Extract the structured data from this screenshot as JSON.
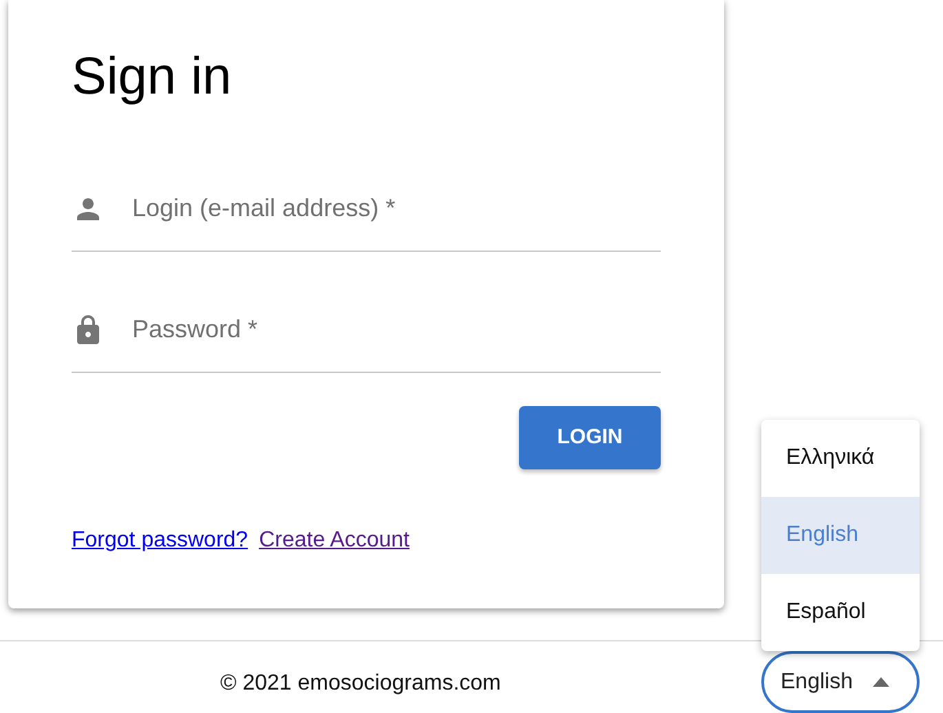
{
  "sign_in": {
    "title": "Sign in",
    "fields": [
      {
        "kind": "user",
        "placeholder": "Login (e-mail address) *"
      },
      {
        "kind": "password",
        "placeholder": "Password *"
      }
    ],
    "login_button": "LOGIN",
    "links": [
      {
        "label": "Forgot password?",
        "visited": false
      },
      {
        "label": "Create Account",
        "visited": true
      }
    ]
  },
  "footer": {
    "copyright": "© 2021 emosociograms.com",
    "language_select": {
      "value": "English",
      "expanded": true,
      "options": [
        {
          "label": "Ελληνικά",
          "selected": false
        },
        {
          "label": "English",
          "selected": true
        },
        {
          "label": "Español",
          "selected": false
        }
      ]
    }
  }
}
